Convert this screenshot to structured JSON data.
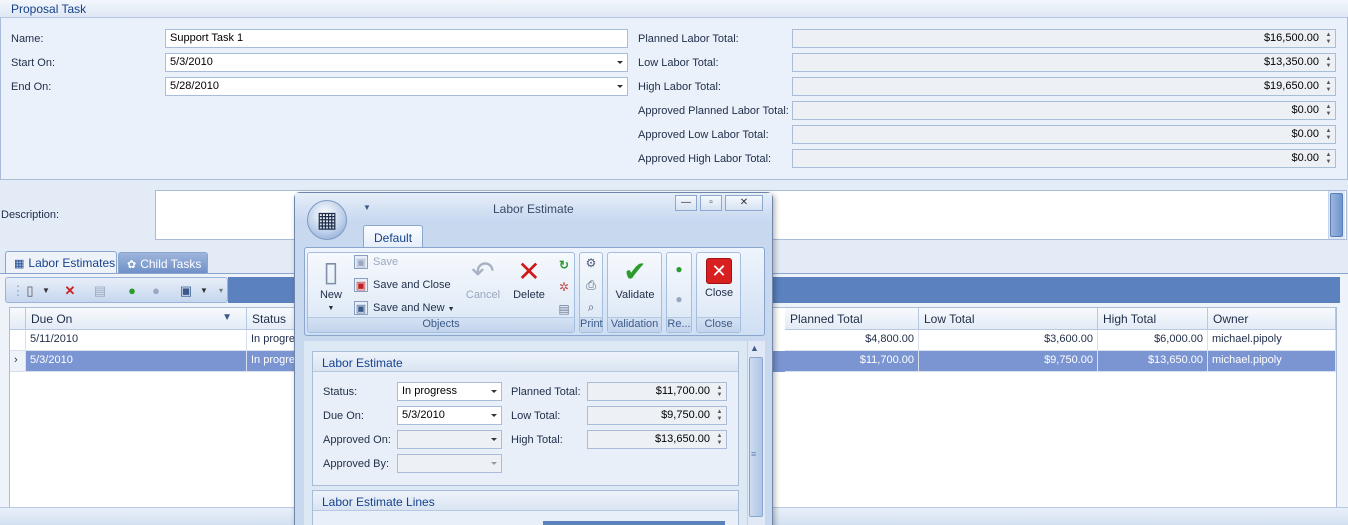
{
  "group": {
    "title": "Proposal Task"
  },
  "form": {
    "name_label": "Name:",
    "name_value": "Support Task 1",
    "start_label": "Start On:",
    "start_value": "5/3/2010",
    "end_label": "End On:",
    "end_value": "5/28/2010",
    "desc_label": "Description:"
  },
  "totals": [
    {
      "label": "Planned Labor Total:",
      "value": "$16,500.00"
    },
    {
      "label": "Low Labor Total:",
      "value": "$13,350.00"
    },
    {
      "label": "High Labor Total:",
      "value": "$19,650.00"
    },
    {
      "label": "Approved Planned Labor Total:",
      "value": "$0.00"
    },
    {
      "label": "Approved Low Labor Total:",
      "value": "$0.00"
    },
    {
      "label": "Approved High Labor Total:",
      "value": "$0.00"
    }
  ],
  "tabs": {
    "labor": "Labor Estimates",
    "child": "Child Tasks"
  },
  "grid": {
    "headers": {
      "due": "Due On",
      "status": "Status",
      "planned": "Planned Total",
      "low": "Low Total",
      "high": "High Total",
      "owner": "Owner"
    },
    "rows": [
      {
        "due": "5/11/2010",
        "status": "In progre",
        "planned": "$4,800.00",
        "low": "$3,600.00",
        "high": "$6,000.00",
        "owner": "michael.pipoly"
      },
      {
        "due": "5/3/2010",
        "status": "In progre",
        "planned": "$11,700.00",
        "low": "$9,750.00",
        "high": "$13,650.00",
        "owner": "michael.pipoly"
      }
    ]
  },
  "dialog": {
    "title": "Labor Estimate",
    "ribbon_tab": "Default",
    "buttons": {
      "new": "New",
      "save": "Save",
      "save_close": "Save and Close",
      "save_new": "Save and New",
      "cancel": "Cancel",
      "delete": "Delete",
      "validate": "Validate",
      "close": "Close"
    },
    "groups": {
      "objects": "Objects",
      "print": "Print",
      "validation": "Validation",
      "re": "Re...",
      "close": "Close"
    },
    "section1": "Labor Estimate",
    "section2": "Labor Estimate Lines",
    "status_label": "Status:",
    "status_value": "In progress",
    "due_label": "Due On:",
    "due_value": "5/3/2010",
    "approved_on_label": "Approved On:",
    "approved_by_label": "Approved By:",
    "planned_label": "Planned Total:",
    "planned_value": "$11,700.00",
    "low_label": "Low Total:",
    "low_value": "$9,750.00",
    "high_label": "High Total:",
    "high_value": "$13,650.00"
  },
  "colors": {
    "selection": "#7b95d2",
    "accent": "#15428b",
    "toolbar_blue": "#5b82bf"
  }
}
